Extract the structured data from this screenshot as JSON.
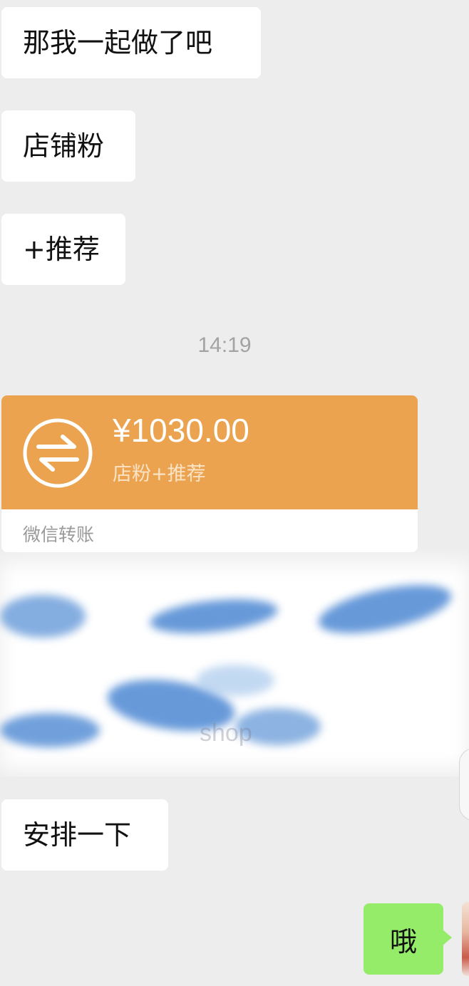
{
  "messages": {
    "msg1": "那我一起做了吧",
    "msg2": "店铺粉",
    "msg3": "+推荐",
    "timestamp": "14:19",
    "msg4": "安排一下",
    "msg5": "哦"
  },
  "transfer": {
    "amount": "¥1030.00",
    "note": "店粉+推荐",
    "label": "微信转账",
    "accent_color": "#eca350"
  },
  "redaction": {
    "visible_text": "shop"
  },
  "icons": {
    "transfer": "transfer-arrows-icon"
  },
  "colors": {
    "background": "#ededed",
    "incoming_bubble": "#ffffff",
    "outgoing_bubble": "#95ec69"
  }
}
